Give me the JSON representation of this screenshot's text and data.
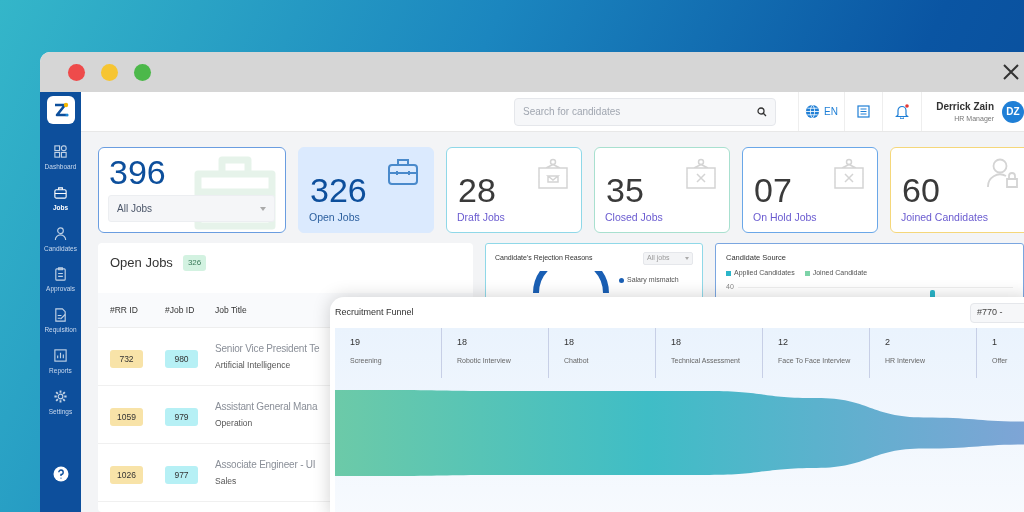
{
  "sidebar": {
    "items": [
      {
        "label": "Dashboard",
        "selected": false
      },
      {
        "label": "Jobs",
        "selected": true
      },
      {
        "label": "Candidates",
        "selected": false
      },
      {
        "label": "Approvals",
        "selected": false
      },
      {
        "label": "Requisition",
        "selected": false
      },
      {
        "label": "Reports",
        "selected": false
      },
      {
        "label": "Settings",
        "selected": false
      }
    ]
  },
  "header": {
    "search": {
      "placeholder": "Search for candidates"
    },
    "language": "EN",
    "unread_notifications": true,
    "user": {
      "name": "Derrick Zain",
      "role": "HR Manager",
      "initials": "DZ"
    }
  },
  "stats": [
    {
      "kind": "dropdown",
      "value": "396",
      "label": "All Jobs",
      "selected": false,
      "color": "#6a9de0"
    },
    {
      "kind": "stat",
      "value": "326",
      "label": "Open Jobs",
      "selected": true,
      "color": "#dbeafe"
    },
    {
      "kind": "stat",
      "value": "28",
      "label": "Draft Jobs",
      "selected": false,
      "color": "#8fd8e8"
    },
    {
      "kind": "stat",
      "value": "35",
      "label": "Closed Jobs",
      "selected": false,
      "color": "#a8e0cf"
    },
    {
      "kind": "stat",
      "value": "07",
      "label": "On Hold Jobs",
      "selected": false,
      "color": "#6aa7e8"
    },
    {
      "kind": "stat",
      "value": "60",
      "label": "Joined Candidates",
      "selected": false,
      "color": "#f5d77a"
    }
  ],
  "open_jobs": {
    "title": "Open Jobs",
    "count": "326",
    "columns": [
      "#RR ID",
      "#Job ID",
      "Job Title"
    ],
    "rows": [
      {
        "rr_id": "732",
        "job_id": "980",
        "title": "Senior Vice President Te",
        "department": "Artificial Intelligence"
      },
      {
        "rr_id": "1059",
        "job_id": "979",
        "title": "Assistant General Mana",
        "department": "Operation"
      },
      {
        "rr_id": "1026",
        "job_id": "977",
        "title": "Associate Engineer - UI",
        "department": "Sales"
      }
    ]
  },
  "rejection": {
    "title": "Candidate's Rejection Reasons",
    "filter": "All jobs",
    "legend": [
      {
        "label": "Salary mismatch",
        "color": "#1a5fb4"
      }
    ]
  },
  "source": {
    "title": "Candidate Source",
    "legend": [
      {
        "label": "Applied Candidates",
        "color": "#2bb5c9"
      },
      {
        "label": "Joined Candidate",
        "color": "#7dd3a8"
      }
    ],
    "y_tick": "40"
  },
  "funnel": {
    "title": "Recruitment Funnel",
    "filter": "#770 -",
    "stages": [
      {
        "count": "19",
        "label": "Screening"
      },
      {
        "count": "18",
        "label": "Robotic Interview"
      },
      {
        "count": "18",
        "label": "Chatbot"
      },
      {
        "count": "18",
        "label": "Technical Assessment"
      },
      {
        "count": "12",
        "label": "Face To Face Interview"
      },
      {
        "count": "2",
        "label": "HR Interview"
      },
      {
        "count": "1",
        "label": "Offer"
      }
    ]
  }
}
